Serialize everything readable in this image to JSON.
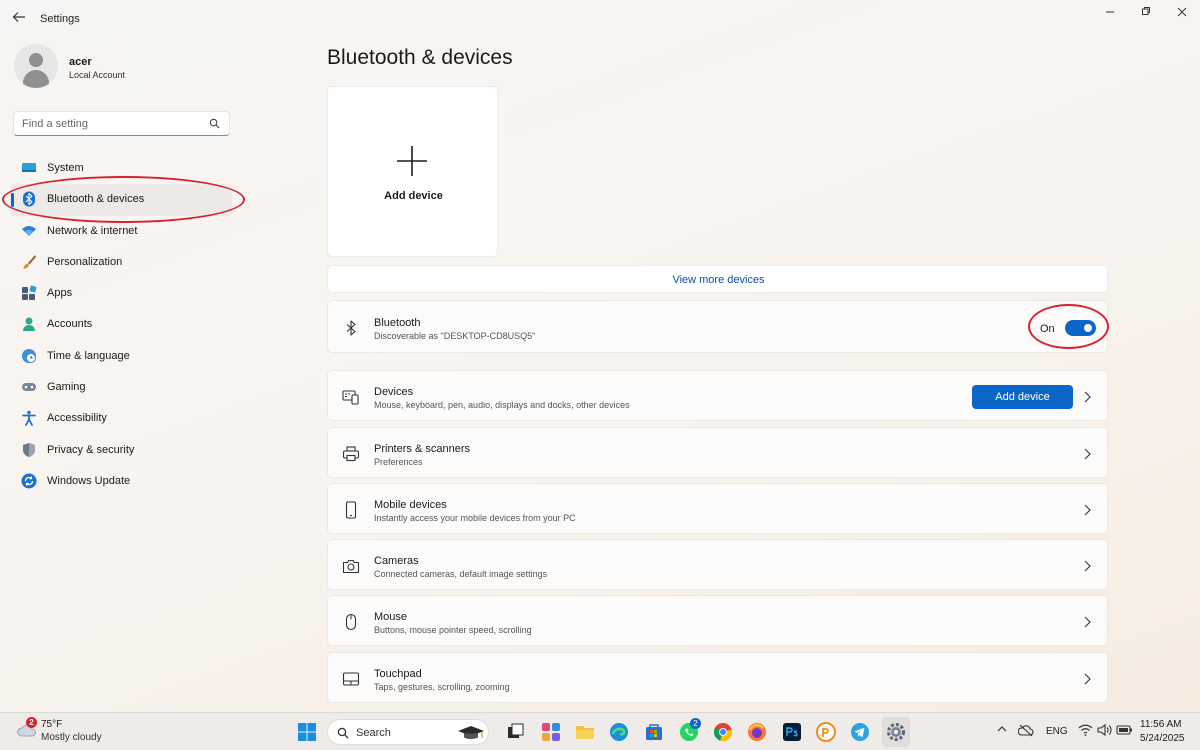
{
  "window": {
    "title": "Settings"
  },
  "profile": {
    "name": "acer",
    "account_type": "Local Account"
  },
  "search": {
    "placeholder": "Find a setting"
  },
  "sidebar": {
    "items": [
      {
        "label": "System",
        "icon": "monitor-icon"
      },
      {
        "label": "Bluetooth & devices",
        "icon": "bluetooth-icon",
        "active": true
      },
      {
        "label": "Network & internet",
        "icon": "wifi-icon"
      },
      {
        "label": "Personalization",
        "icon": "paintbrush-icon"
      },
      {
        "label": "Apps",
        "icon": "apps-icon"
      },
      {
        "label": "Accounts",
        "icon": "person-icon"
      },
      {
        "label": "Time & language",
        "icon": "globe-clock-icon"
      },
      {
        "label": "Gaming",
        "icon": "gamepad-icon"
      },
      {
        "label": "Accessibility",
        "icon": "accessibility-icon"
      },
      {
        "label": "Privacy & security",
        "icon": "shield-icon"
      },
      {
        "label": "Windows Update",
        "icon": "update-icon"
      }
    ]
  },
  "main": {
    "title": "Bluetooth & devices",
    "add_device_card_label": "Add device",
    "view_more_label": "View more devices",
    "bluetooth": {
      "title": "Bluetooth",
      "subtitle": "Discoverable as \"DESKTOP-CD8USQ5\"",
      "toggle_label": "On",
      "enabled": true
    },
    "cards": [
      {
        "title": "Devices",
        "subtitle": "Mouse, keyboard, pen, audio, displays and docks, other devices",
        "icon": "devices-icon",
        "button": "Add device"
      },
      {
        "title": "Printers & scanners",
        "subtitle": "Preferences",
        "icon": "printer-icon"
      },
      {
        "title": "Mobile devices",
        "subtitle": "Instantly access your mobile devices from your PC",
        "icon": "phone-icon"
      },
      {
        "title": "Cameras",
        "subtitle": "Connected cameras, default image settings",
        "icon": "camera-icon"
      },
      {
        "title": "Mouse",
        "subtitle": "Buttons, mouse pointer speed, scrolling",
        "icon": "mouse-icon"
      },
      {
        "title": "Touchpad",
        "subtitle": "Taps, gestures, scrolling, zooming",
        "icon": "touchpad-icon"
      }
    ]
  },
  "taskbar": {
    "weather": {
      "temp": "75°F",
      "condition": "Mostly cloudy",
      "badge": "2"
    },
    "search_label": "Search",
    "whatsapp_badge": "2",
    "language": "ENG",
    "time": "11:56 AM",
    "date": "5/24/2025"
  },
  "colors": {
    "accent": "#0a67c8",
    "annotation_red": "#d6242f"
  }
}
